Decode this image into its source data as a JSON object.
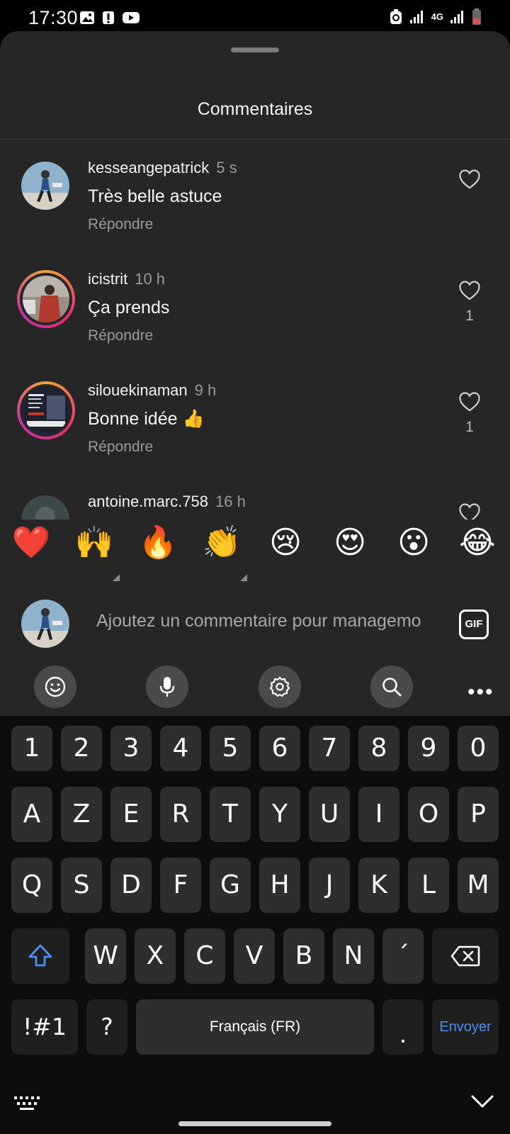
{
  "status_bar": {
    "time": "17:30",
    "left_icons": [
      "gallery-icon",
      "alert-icon",
      "youtube-icon"
    ],
    "right_icons": [
      "recycle-icon",
      "signal-icon",
      "4g-icon",
      "signal-icon",
      "battery-icon"
    ],
    "network": "4G"
  },
  "sheet": {
    "title": "Commentaires"
  },
  "comments": [
    {
      "username": "kesseangepatrick",
      "time": "5 s",
      "text": "Très belle astuce",
      "reply_label": "Répondre",
      "likes": "",
      "ring": false
    },
    {
      "username": "icistrit",
      "time": "10 h",
      "text": "Ça prends",
      "reply_label": "Répondre",
      "likes": "1",
      "ring": true
    },
    {
      "username": "silouekinaman",
      "time": "9 h",
      "text": "Bonne idée 👍",
      "reply_label": "Répondre",
      "likes": "1",
      "ring": true
    },
    {
      "username": "antoine.marc.758",
      "time": "16 h",
      "text": "",
      "reply_label": "",
      "likes": "",
      "ring": false
    }
  ],
  "emoji_bar": [
    "❤️",
    "🙌",
    "🔥",
    "👏",
    "😢",
    "😍",
    "😮",
    "😂"
  ],
  "compose": {
    "placeholder": "Ajoutez un commentaire pour managemo",
    "gif_label": "GIF"
  },
  "keyboard_toolbar": {
    "icons": [
      "emoji-icon",
      "microphone-icon",
      "settings-icon",
      "search-icon",
      "more-icon"
    ],
    "more_label": "•••"
  },
  "keyboard": {
    "number_row": [
      "1",
      "2",
      "3",
      "4",
      "5",
      "6",
      "7",
      "8",
      "9",
      "0"
    ],
    "row1": [
      "A",
      "Z",
      "E",
      "R",
      "T",
      "Y",
      "U",
      "I",
      "O",
      "P"
    ],
    "row2": [
      "Q",
      "S",
      "D",
      "F",
      "G",
      "H",
      "J",
      "K",
      "L",
      "M"
    ],
    "row3": [
      "W",
      "X",
      "C",
      "V",
      "B",
      "N",
      "´"
    ],
    "symbols_label": "!#1",
    "question_label": "?",
    "space_label": "Français (FR)",
    "period_label": ".",
    "send_label": "Envoyer"
  },
  "colors": {
    "sheet_bg": "#262626",
    "keyboard_bg": "#0d0d0d",
    "key_bg": "#2e2e2e",
    "send_color": "#4c8ef5",
    "ring_gradient": [
      "#f0a33b",
      "#e8336b",
      "#c02fa8"
    ]
  }
}
